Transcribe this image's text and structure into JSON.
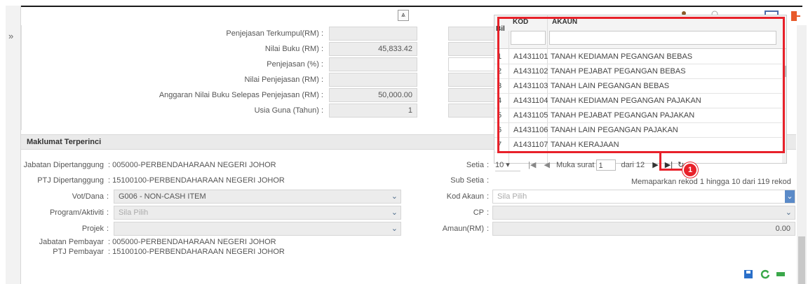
{
  "top_fields": [
    {
      "label": "Penjejasan Terkumpul(RM) :",
      "value": ""
    },
    {
      "label": "Nilai Buku (RM) :",
      "value": "45,833.42"
    },
    {
      "label": "Penjejasan (%) :",
      "value": ""
    },
    {
      "label": "Nilai Penjejasan (RM) :",
      "value": ""
    },
    {
      "label": "Anggaran Nilai Buku Selepas Penjejasan (RM) :",
      "value": "50,000.00"
    },
    {
      "label": "Usia Guna (Tahun) :",
      "value": "1"
    }
  ],
  "section": {
    "title": "Maklumat Terperinci"
  },
  "details": {
    "jabatan_label": "Jabatan Dipertanggung",
    "jabatan_value": ": 005000-PERBENDAHARAAN NEGERI JOHOR",
    "ptj_label": "PTJ Dipertanggung",
    "ptj_value": ": 15100100-PERBENDAHARAAN NEGERI JOHOR",
    "vot_label": "Vot/Dana",
    "vot_value": "G006 - NON-CASH ITEM",
    "program_label": "Program/Aktiviti",
    "program_placeholder": "Sila Pilih",
    "projek_label": "Projek",
    "jabatan_bayar_label": "Jabatan Pembayar",
    "jabatan_bayar_value": ": 005000-PERBENDAHARAAN NEGERI JOHOR",
    "ptj_bayar_label": "PTJ Pembayar",
    "ptj_bayar_value": ": 15100100-PERBENDAHARAAN NEGERI JOHOR"
  },
  "right_fields": {
    "setia_label": "Setia",
    "sub_setia_label": "Sub Setia",
    "kod_akaun_label": "Kod Akaun",
    "kod_akaun_placeholder": "Sila Pilih",
    "cp_label": "CP",
    "amaun_label": "Amaun(RM)",
    "amaun_value": "0.00"
  },
  "dropdown": {
    "col_bil": "Bil",
    "col_kod": "KOD",
    "col_akaun": "AKAUN",
    "rows": [
      {
        "n": "1",
        "kod": "A1431101",
        "akaun": "TANAH KEDIAMAN PEGANGAN BEBAS"
      },
      {
        "n": "2",
        "kod": "A1431102",
        "akaun": "TANAH PEJABAT PEGANGAN BEBAS"
      },
      {
        "n": "3",
        "kod": "A1431103",
        "akaun": "TANAH LAIN PEGANGAN BEBAS"
      },
      {
        "n": "4",
        "kod": "A1431104",
        "akaun": "TANAH KEDIAMAN PEGANGAN PAJAKAN"
      },
      {
        "n": "5",
        "kod": "A1431105",
        "akaun": "TANAH PEJABAT PEGANGAN PAJAKAN"
      },
      {
        "n": "6",
        "kod": "A1431106",
        "akaun": "TANAH LAIN PEGANGAN PAJAKAN"
      },
      {
        "n": "7",
        "kod": "A1431107",
        "akaun": "TANAH KERAJAAN"
      }
    ]
  },
  "pager": {
    "page_size": "10",
    "muka_surat_label": "Muka surat",
    "page": "1",
    "dari_label": "dari 12",
    "summary": "Memaparkan rekod 1 hingga 10 dari 119 rekod"
  },
  "callout": {
    "number": "1"
  },
  "colors": {
    "highlight": "#e8212a",
    "save": "#2a6fc9",
    "refresh": "#3aa84a",
    "exit": "#e85a2a"
  },
  "icons": {
    "collapse": "⩓",
    "expand": "»"
  }
}
